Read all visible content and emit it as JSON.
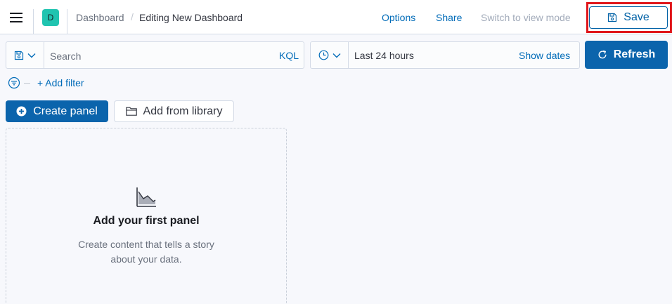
{
  "header": {
    "space_initial": "D",
    "breadcrumb_root": "Dashboard",
    "breadcrumb_separator": "/",
    "breadcrumb_current": "Editing New Dashboard",
    "options_label": "Options",
    "share_label": "Share",
    "view_mode_label": "Switch to view mode",
    "save_label": "Save"
  },
  "query_bar": {
    "search_placeholder": "Search",
    "language_label": "KQL"
  },
  "date_picker": {
    "range_label": "Last 24 hours",
    "show_dates_label": "Show dates"
  },
  "refresh_label": "Refresh",
  "filters": {
    "add_filter_label": "+ Add filter"
  },
  "toolbar": {
    "create_panel_label": "Create panel",
    "add_from_library_label": "Add from library"
  },
  "empty_state": {
    "title": "Add your first panel",
    "description": "Create content that tells a story about your data."
  },
  "colors": {
    "primary": "#0b64ac",
    "link": "#006bb8",
    "space_avatar": "#20c4b0",
    "highlight": "#e0161b"
  },
  "icons": {
    "menu": "hamburger-icon",
    "save": "save-icon",
    "saved_query": "save-icon",
    "quick_select": "clock-icon",
    "refresh": "refresh-icon",
    "filter": "filter-icon",
    "create_panel": "plus-circle-icon",
    "library": "folder-icon",
    "empty_state": "area-chart-icon"
  }
}
